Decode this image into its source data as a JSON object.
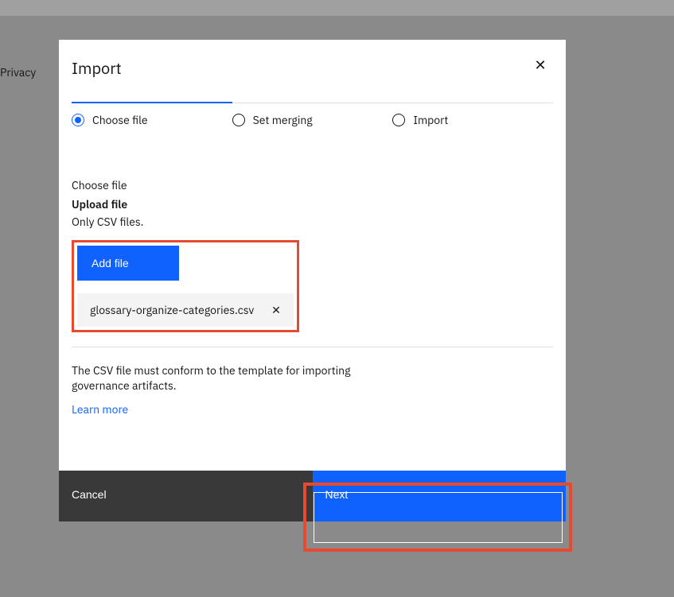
{
  "background": {
    "sidebar_label": "Privacy"
  },
  "modal": {
    "title": "Import",
    "close_label": "✕",
    "steps": [
      {
        "label": "Choose file",
        "active": true
      },
      {
        "label": "Set merging",
        "active": false
      },
      {
        "label": "Import",
        "active": false
      }
    ],
    "body": {
      "section_label": "Choose file",
      "upload_title": "Upload file",
      "upload_hint": "Only CSV files.",
      "add_file_label": "Add file",
      "selected_file": "glossary-organize-categories.csv",
      "hint": "The CSV file must conform to the template for importing governance artifacts.",
      "learn_more": "Learn more"
    },
    "footer": {
      "cancel": "Cancel",
      "next": "Next"
    }
  }
}
